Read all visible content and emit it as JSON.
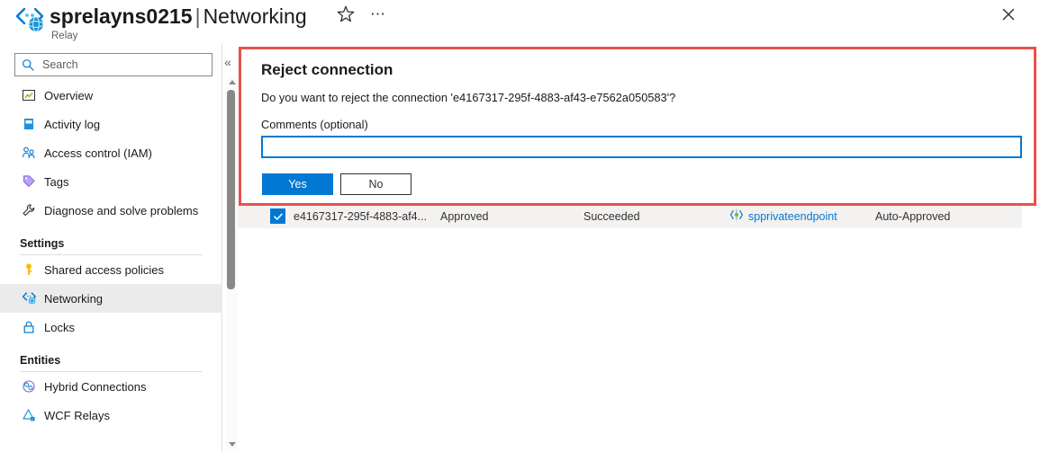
{
  "header": {
    "resource_icon": "relay-icon",
    "resource_name": "sprelayns0215",
    "separator": "|",
    "page_name": "Networking",
    "subtitle": "Relay",
    "favorite_icon": "star-icon",
    "more_icon": "ellipsis-icon",
    "close_icon": "close-icon"
  },
  "sidebar": {
    "search": {
      "placeholder": "Search",
      "value": "",
      "icon": "search-icon"
    },
    "collapse_icon": "«",
    "items": [
      {
        "label": "Overview",
        "icon": "overview-icon",
        "selected": false
      },
      {
        "label": "Activity log",
        "icon": "activity-log-icon",
        "selected": false
      },
      {
        "label": "Access control (IAM)",
        "icon": "access-control-icon",
        "selected": false
      },
      {
        "label": "Tags",
        "icon": "tags-icon",
        "selected": false
      },
      {
        "label": "Diagnose and solve problems",
        "icon": "diagnose-icon",
        "selected": false
      }
    ],
    "groups": [
      {
        "label": "Settings",
        "items": [
          {
            "label": "Shared access policies",
            "icon": "key-icon",
            "selected": false
          },
          {
            "label": "Networking",
            "icon": "networking-icon",
            "selected": true
          },
          {
            "label": "Locks",
            "icon": "lock-icon",
            "selected": false
          }
        ]
      },
      {
        "label": "Entities",
        "items": [
          {
            "label": "Hybrid Connections",
            "icon": "hybrid-connections-icon",
            "selected": false
          },
          {
            "label": "WCF Relays",
            "icon": "wcf-relays-icon",
            "selected": false
          }
        ]
      }
    ],
    "scrollbar": {
      "up_icon": "scroll-up-arrow",
      "down_icon": "scroll-down-arrow"
    }
  },
  "dialog": {
    "title": "Reject connection",
    "message": "Do you want to reject the connection 'e4167317-295f-4883-af43-e7562a050583'?",
    "comments_label": "Comments (optional)",
    "comments_value": "",
    "comments_placeholder": "",
    "yes_label": "Yes",
    "no_label": "No",
    "accent_color": "#0078d4",
    "highlight_color": "#e8514b"
  },
  "table": {
    "row": {
      "selected": true,
      "checkbox_icon": "checkmark-icon",
      "name": "e4167317-295f-4883-af4...",
      "connection_state": "Approved",
      "provisioning_state": "Succeeded",
      "private_endpoint_icon": "private-endpoint-icon",
      "private_endpoint": "spprivateendpoint",
      "description": "Auto-Approved"
    }
  }
}
